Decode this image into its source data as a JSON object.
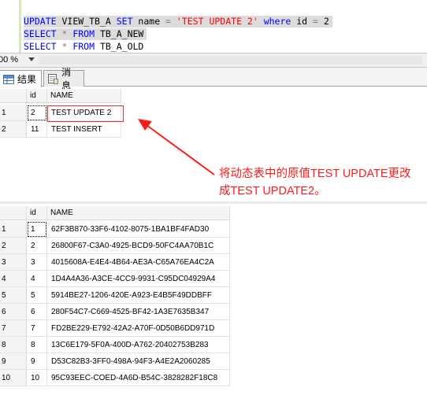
{
  "editor": {
    "top_fragment": "- -",
    "line1": {
      "kw1": "UPDATE",
      "t1": " VIEW_TB_A ",
      "kw2": "SET",
      "t2": " name ",
      "op1": "=",
      "str1": " 'TEST UPDATE 2' ",
      "kw3": "where",
      "t3": " id ",
      "op2": "=",
      "t4": " 2"
    },
    "line2": {
      "kw1": "SELECT",
      "op1": " * ",
      "kw2": "FROM",
      "t1": " TB_A_NEW"
    },
    "line3": {
      "kw1": "SELECT",
      "op1": " * ",
      "kw2": "FROM",
      "t1": " TB_A_OLD"
    }
  },
  "zoom": {
    "value": "00 %"
  },
  "tabs": [
    {
      "label": "结果",
      "icon": "grid-icon",
      "active": true
    },
    {
      "label": "消息",
      "icon": "message-icon",
      "active": false
    }
  ],
  "grid1": {
    "columns": [
      "id",
      "NAME"
    ],
    "rows": [
      {
        "rownum": "1",
        "id": "2",
        "name": "TEST UPDATE 2"
      },
      {
        "rownum": "2",
        "id": "11",
        "name": "TEST INSERT"
      }
    ]
  },
  "annotation": {
    "line1": "将动态表中的原值TEST UPDATE更改",
    "line2": "成TEST UPDATE2。",
    "color": "#ff1a1a"
  },
  "grid2": {
    "columns": [
      "id",
      "NAME"
    ],
    "rows": [
      {
        "rownum": "1",
        "id": "1",
        "name": "62F3B870-33F6-4102-8075-1BA1BF4FAD30"
      },
      {
        "rownum": "2",
        "id": "2",
        "name": "26800F67-C3A0-4925-BCD9-50FC4AA70B1C"
      },
      {
        "rownum": "3",
        "id": "3",
        "name": "4015608A-E4E4-4B64-AE3A-C65A76EA4C2A"
      },
      {
        "rownum": "4",
        "id": "4",
        "name": "1D4A4A36-A3CE-4CC9-9931-C95DC04929A4"
      },
      {
        "rownum": "5",
        "id": "5",
        "name": "5914BE27-1206-420E-A923-E4B5F49DDBFF"
      },
      {
        "rownum": "6",
        "id": "6",
        "name": "280F54C7-C669-4525-BF42-1A3E7635B347"
      },
      {
        "rownum": "7",
        "id": "7",
        "name": "FD2BE229-E792-42A2-A70F-0D50B6DD971D"
      },
      {
        "rownum": "8",
        "id": "8",
        "name": "13C6E179-5F0A-400D-A762-20402753B283"
      },
      {
        "rownum": "9",
        "id": "9",
        "name": "D53C82B3-3FF0-498A-94F3-A4E2A2060285"
      },
      {
        "rownum": "10",
        "id": "10",
        "name": "95C93EEC-COED-4A6D-B54C-3828282F18C8"
      }
    ]
  }
}
